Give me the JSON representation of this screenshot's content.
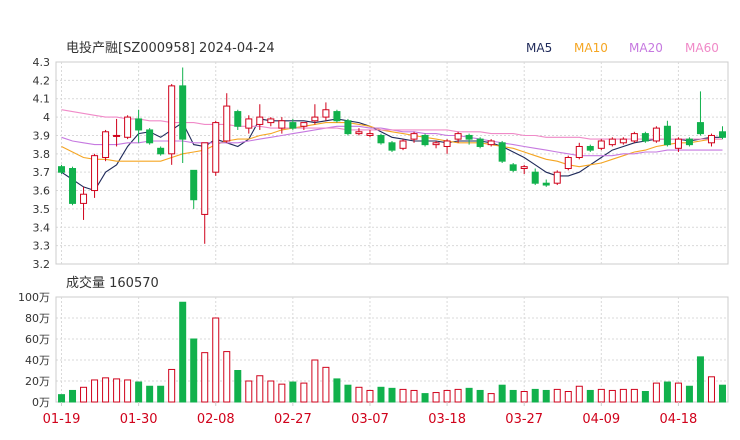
{
  "title": "电投产融[SZ000958] 2024-04-24",
  "legend": [
    {
      "label": "MA5",
      "color": "#1f2a5a"
    },
    {
      "label": "MA10",
      "color": "#f5a623"
    },
    {
      "label": "MA20",
      "color": "#c679e0"
    },
    {
      "label": "MA60",
      "color": "#f08ac8"
    }
  ],
  "colors": {
    "up": "#d0021b",
    "down": "#11b14c",
    "grid": "#d9d9d9",
    "frame": "#cccccc"
  },
  "volume_title": "成交量 160570",
  "chart_data": [
    {
      "type": "candlestick",
      "yticks": [
        "4.3",
        "4.2",
        "4.1",
        "4",
        "3.9",
        "3.8",
        "3.7",
        "3.6",
        "3.5",
        "3.4",
        "3.3",
        "3.2"
      ],
      "ylim": [
        3.2,
        4.3
      ],
      "ohlc": [
        [
          3.73,
          3.74,
          3.69,
          3.7
        ],
        [
          3.72,
          3.73,
          3.52,
          3.53
        ],
        [
          3.53,
          3.62,
          3.44,
          3.58
        ],
        [
          3.6,
          3.8,
          3.56,
          3.79
        ],
        [
          3.78,
          3.93,
          3.76,
          3.92
        ],
        [
          3.9,
          3.99,
          3.84,
          3.9
        ],
        [
          3.89,
          4.01,
          3.88,
          4.0
        ],
        [
          3.99,
          4.04,
          3.86,
          3.93
        ],
        [
          3.93,
          3.94,
          3.85,
          3.86
        ],
        [
          3.83,
          3.84,
          3.79,
          3.8
        ],
        [
          3.8,
          4.18,
          3.74,
          4.17
        ],
        [
          4.17,
          4.27,
          3.75,
          3.88
        ],
        [
          3.71,
          3.71,
          3.5,
          3.55
        ],
        [
          3.47,
          3.86,
          3.31,
          3.86
        ],
        [
          3.7,
          3.98,
          3.68,
          3.97
        ],
        [
          3.87,
          4.13,
          3.86,
          4.06
        ],
        [
          4.03,
          4.04,
          3.93,
          3.95
        ],
        [
          3.94,
          4.01,
          3.91,
          3.99
        ],
        [
          3.96,
          4.07,
          3.93,
          4.0
        ],
        [
          3.97,
          4.0,
          3.95,
          3.99
        ],
        [
          3.94,
          4.0,
          3.91,
          3.98
        ],
        [
          3.97,
          3.99,
          3.93,
          3.94
        ],
        [
          3.95,
          3.97,
          3.93,
          3.97
        ],
        [
          3.98,
          4.07,
          3.96,
          4.0
        ],
        [
          4.0,
          4.08,
          3.98,
          4.04
        ],
        [
          4.03,
          4.04,
          3.97,
          3.98
        ],
        [
          3.98,
          3.99,
          3.9,
          3.91
        ],
        [
          3.91,
          3.94,
          3.9,
          3.92
        ],
        [
          3.9,
          3.93,
          3.89,
          3.91
        ],
        [
          3.9,
          3.91,
          3.85,
          3.86
        ],
        [
          3.86,
          3.87,
          3.81,
          3.82
        ],
        [
          3.83,
          3.88,
          3.82,
          3.87
        ],
        [
          3.88,
          3.92,
          3.86,
          3.91
        ],
        [
          3.9,
          3.91,
          3.84,
          3.85
        ],
        [
          3.85,
          3.87,
          3.83,
          3.86
        ],
        [
          3.84,
          3.88,
          3.8,
          3.87
        ],
        [
          3.88,
          3.92,
          3.86,
          3.91
        ],
        [
          3.9,
          3.91,
          3.85,
          3.88
        ],
        [
          3.88,
          3.89,
          3.83,
          3.84
        ],
        [
          3.85,
          3.88,
          3.84,
          3.87
        ],
        [
          3.86,
          3.87,
          3.75,
          3.76
        ],
        [
          3.74,
          3.75,
          3.7,
          3.71
        ],
        [
          3.72,
          3.74,
          3.69,
          3.73
        ],
        [
          3.7,
          3.72,
          3.63,
          3.64
        ],
        [
          3.64,
          3.66,
          3.62,
          3.63
        ],
        [
          3.64,
          3.71,
          3.63,
          3.7
        ],
        [
          3.72,
          3.79,
          3.71,
          3.78
        ],
        [
          3.78,
          3.86,
          3.77,
          3.84
        ],
        [
          3.84,
          3.85,
          3.81,
          3.82
        ],
        [
          3.83,
          3.88,
          3.82,
          3.87
        ],
        [
          3.85,
          3.89,
          3.84,
          3.88
        ],
        [
          3.86,
          3.89,
          3.85,
          3.88
        ],
        [
          3.87,
          3.92,
          3.86,
          3.91
        ],
        [
          3.91,
          3.92,
          3.86,
          3.87
        ],
        [
          3.87,
          3.95,
          3.86,
          3.94
        ],
        [
          3.95,
          3.98,
          3.84,
          3.85
        ],
        [
          3.83,
          3.89,
          3.81,
          3.88
        ],
        [
          3.88,
          3.89,
          3.84,
          3.85
        ],
        [
          3.97,
          4.14,
          3.9,
          3.91
        ],
        [
          3.86,
          3.91,
          3.84,
          3.9
        ],
        [
          3.92,
          3.95,
          3.88,
          3.89
        ]
      ],
      "ma5": [
        3.7,
        3.66,
        3.62,
        3.6,
        3.7,
        3.74,
        3.84,
        3.91,
        3.92,
        3.89,
        3.93,
        3.97,
        3.85,
        3.84,
        3.88,
        3.86,
        3.84,
        3.88,
        3.99,
        3.98,
        3.98,
        3.98,
        3.98,
        3.97,
        3.98,
        3.99,
        3.98,
        3.97,
        3.95,
        3.92,
        3.89,
        3.88,
        3.87,
        3.87,
        3.87,
        3.86,
        3.87,
        3.87,
        3.87,
        3.86,
        3.84,
        3.81,
        3.78,
        3.74,
        3.7,
        3.68,
        3.68,
        3.7,
        3.74,
        3.78,
        3.82,
        3.84,
        3.86,
        3.87,
        3.88,
        3.88,
        3.88,
        3.87,
        3.88,
        3.89,
        3.89
      ],
      "ma10": [
        3.84,
        3.81,
        3.78,
        3.77,
        3.77,
        3.76,
        3.76,
        3.76,
        3.76,
        3.76,
        3.78,
        3.8,
        3.81,
        3.82,
        3.85,
        3.87,
        3.88,
        3.88,
        3.9,
        3.91,
        3.93,
        3.94,
        3.95,
        3.96,
        3.97,
        3.97,
        3.97,
        3.96,
        3.95,
        3.93,
        3.92,
        3.91,
        3.9,
        3.89,
        3.88,
        3.87,
        3.86,
        3.86,
        3.86,
        3.85,
        3.84,
        3.83,
        3.81,
        3.79,
        3.77,
        3.76,
        3.74,
        3.73,
        3.74,
        3.75,
        3.77,
        3.79,
        3.81,
        3.82,
        3.84,
        3.85,
        3.86,
        3.86,
        3.87,
        3.88,
        3.88
      ],
      "ma20": [
        3.89,
        3.87,
        3.86,
        3.85,
        3.85,
        3.85,
        3.86,
        3.86,
        3.87,
        3.87,
        3.87,
        3.87,
        3.86,
        3.86,
        3.86,
        3.86,
        3.86,
        3.87,
        3.88,
        3.89,
        3.9,
        3.91,
        3.92,
        3.93,
        3.94,
        3.95,
        3.95,
        3.95,
        3.94,
        3.94,
        3.93,
        3.92,
        3.92,
        3.91,
        3.91,
        3.9,
        3.9,
        3.89,
        3.88,
        3.87,
        3.86,
        3.85,
        3.84,
        3.83,
        3.82,
        3.81,
        3.8,
        3.79,
        3.79,
        3.79,
        3.79,
        3.8,
        3.8,
        3.81,
        3.81,
        3.82,
        3.82,
        3.82,
        3.82,
        3.82,
        3.82
      ],
      "ma60": [
        4.04,
        4.03,
        4.02,
        4.01,
        4.0,
        4.0,
        3.99,
        3.99,
        3.98,
        3.98,
        3.97,
        3.97,
        3.97,
        3.96,
        3.96,
        3.96,
        3.95,
        3.95,
        3.95,
        3.94,
        3.94,
        3.94,
        3.94,
        3.94,
        3.94,
        3.94,
        3.93,
        3.93,
        3.93,
        3.93,
        3.93,
        3.93,
        3.93,
        3.93,
        3.93,
        3.93,
        3.92,
        3.92,
        3.92,
        3.91,
        3.91,
        3.91,
        3.9,
        3.9,
        3.89,
        3.89,
        3.89,
        3.89,
        3.88,
        3.88,
        3.88,
        3.88,
        3.88,
        3.88,
        3.88,
        3.88,
        3.88,
        3.88,
        3.88,
        3.88,
        3.88
      ]
    },
    {
      "type": "bar",
      "yticks": [
        "100万",
        "80万",
        "60万",
        "40万",
        "20万",
        "0万"
      ],
      "ylim": [
        0,
        100
      ],
      "unit": "万",
      "values": [
        7,
        11,
        14,
        21,
        23,
        22,
        21,
        19,
        15,
        15,
        31,
        95,
        60,
        47,
        80,
        48,
        30,
        20,
        25,
        20,
        17,
        19,
        18,
        40,
        33,
        22,
        16,
        14,
        11,
        14,
        13,
        12,
        11,
        8,
        9,
        11,
        12,
        13,
        11,
        8,
        16,
        11,
        10,
        12,
        11,
        12,
        10,
        15,
        11,
        12,
        11,
        12,
        12,
        10,
        18,
        19,
        18,
        15,
        43,
        24,
        16
      ],
      "xticks": [
        {
          "label": "01-19",
          "index": 0
        },
        {
          "label": "01-30",
          "index": 7
        },
        {
          "label": "02-08",
          "index": 14
        },
        {
          "label": "02-27",
          "index": 21
        },
        {
          "label": "03-07",
          "index": 28
        },
        {
          "label": "03-18",
          "index": 35
        },
        {
          "label": "03-27",
          "index": 42
        },
        {
          "label": "04-09",
          "index": 49
        },
        {
          "label": "04-18",
          "index": 56
        }
      ]
    }
  ]
}
